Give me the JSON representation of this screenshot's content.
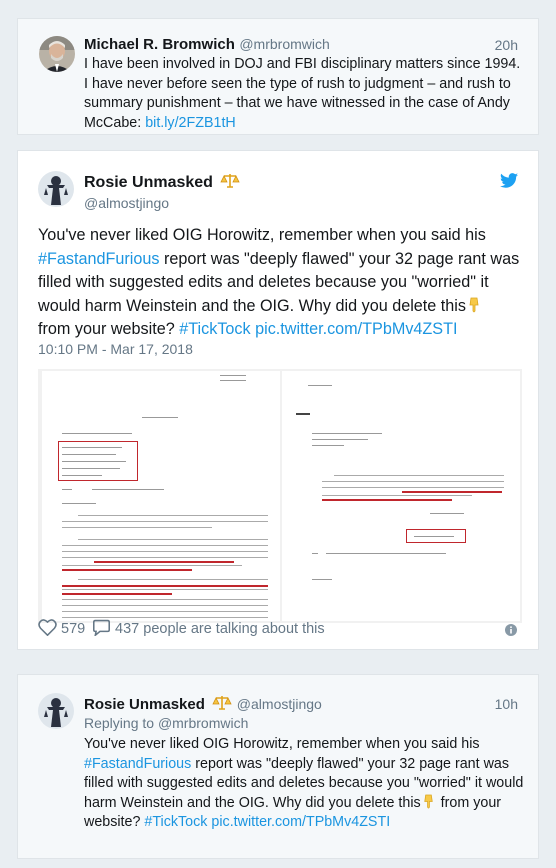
{
  "tweet1": {
    "name": "Michael R. Bromwich",
    "handle": "@mrbromwich",
    "time": "20h",
    "text": "I have been involved in DOJ and FBI disciplinary matters since 1994. I have never before seen the type of rush to judgment – and rush to summary punishment – that we have witnessed in the case of Andy McCabe: ",
    "link": "bit.ly/2FZB1tH"
  },
  "tweet2": {
    "name": "Rosie Unmasked",
    "handle": "@almostjingo",
    "text_before_hashtag": "You've never liked OIG Horowitz, remember when you said his ",
    "hashtag1": "#FastandFurious",
    "text_middle": " report was \"deeply flawed\" your 32 page rant was filled with suggested edits and deletes because you \"worried\" it would harm Weinstein and the OIG. Why did you delete this",
    "text_after_emoji": " from your website? ",
    "hashtag2": "#TickTock",
    "pic_link": "pic.twitter.com/TPbMv4ZSTI",
    "timestamp": "10:10 PM - Mar 17, 2018",
    "likes": "579",
    "talking": "437 people are talking about this",
    "icons": [
      "twitter-bird-icon",
      "scales-badge-icon",
      "pointing-down-emoji",
      "heart-icon",
      "comment-icon",
      "info-icon"
    ]
  },
  "tweet3": {
    "name": "Rosie Unmasked",
    "handle": "@almostjingo",
    "time": "10h",
    "replying_prefix": "Replying to ",
    "replying_to": "@mrbromwich",
    "text_before_hashtag": "You've never liked OIG Horowitz, remember when you said his ",
    "hashtag1": "#FastandFurious",
    "text_middle": " report was \"deeply flawed\" your 32 page rant was filled with suggested edits and deletes because you \"worried\" it would harm Weinstein and the OIG. Why did you delete this",
    "text_after_emoji": " from your website? ",
    "hashtag2": "#TickTock",
    "pic_link": "pic.twitter.com/TPbMv4ZSTI"
  },
  "colors": {
    "link": "#1b95e0",
    "muted": "#657786",
    "background": "#e9eef2",
    "twitter_blue": "#1da1f2",
    "annotation_red": "#c0272d"
  }
}
